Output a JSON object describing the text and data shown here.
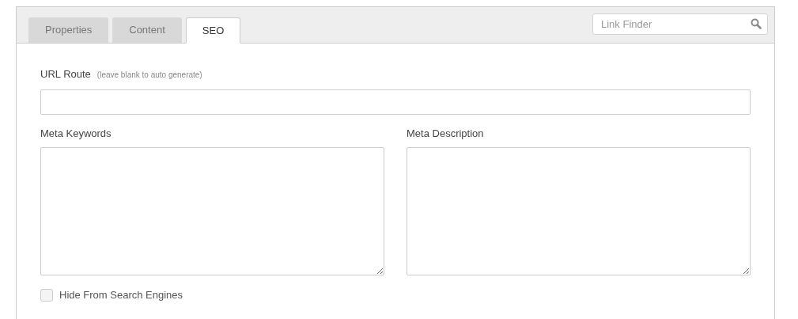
{
  "tabs": [
    {
      "label": "Properties",
      "selected": false
    },
    {
      "label": "Content",
      "selected": false
    },
    {
      "label": "SEO",
      "selected": true
    }
  ],
  "search": {
    "placeholder": "Link Finder"
  },
  "url_route": {
    "label": "URL Route",
    "hint": "(leave blank to auto generate)"
  },
  "meta_keywords": {
    "label": "Meta Keywords"
  },
  "meta_description": {
    "label": "Meta Description"
  },
  "hide_from_search": {
    "label": "Hide From Search Engines",
    "checked": false
  }
}
